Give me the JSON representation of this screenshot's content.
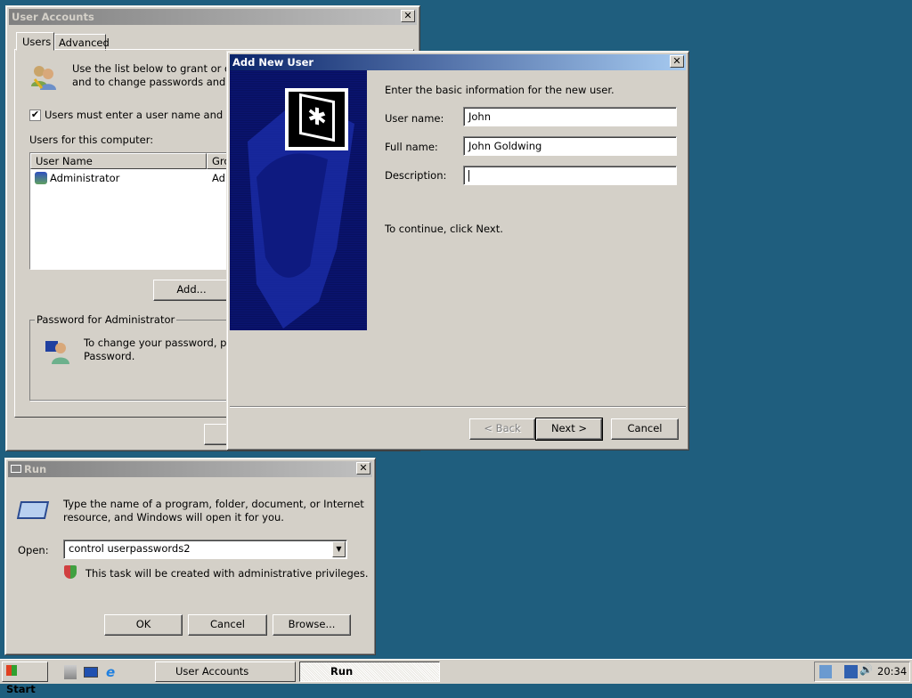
{
  "user_accounts": {
    "title": "User Accounts",
    "tabs": [
      "Users",
      "Advanced"
    ],
    "intro_line1": "Use the list below to grant or den",
    "intro_line2": "and to change passwords and oth",
    "checkbox_label": "Users must enter a user name and pass",
    "checkbox_checked": true,
    "list_label": "Users for this computer:",
    "columns": [
      "User Name",
      "Gro"
    ],
    "rows": [
      {
        "name": "Administrator",
        "group": "Adı"
      }
    ],
    "add_button": "Add...",
    "group_title": "Password for Administrator",
    "password_line1": "To change your password, pres",
    "password_line2": "Password."
  },
  "add_user": {
    "title": "Add New User",
    "instruction": "Enter the basic information for the new user.",
    "fields": [
      {
        "label": "User name:",
        "value": "John"
      },
      {
        "label": "Full name:",
        "value": "John Goldwing"
      },
      {
        "label": "Description:",
        "value": ""
      }
    ],
    "continue_text": "To continue, click Next.",
    "back": "< Back",
    "next": "Next >",
    "cancel": "Cancel"
  },
  "run": {
    "title": "Run",
    "description_line1": "Type the name of a program, folder, document, or Internet",
    "description_line2": "resource, and Windows will open it for you.",
    "open_label": "Open:",
    "open_value": "control userpasswords2",
    "admin_note": "This task will be created with administrative privileges.",
    "ok": "OK",
    "cancel": "Cancel",
    "browse": "Browse..."
  },
  "taskbar": {
    "start": "Start",
    "tasks": [
      "User Accounts",
      "Run"
    ],
    "clock": "20:34"
  }
}
